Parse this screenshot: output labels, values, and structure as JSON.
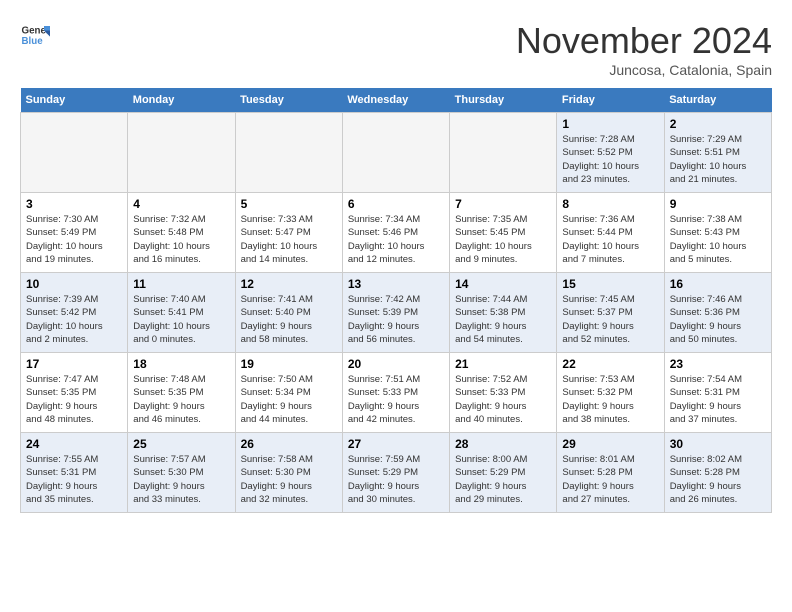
{
  "logo": {
    "line1": "General",
    "line2": "Blue"
  },
  "title": "November 2024",
  "subtitle": "Juncosa, Catalonia, Spain",
  "weekdays": [
    "Sunday",
    "Monday",
    "Tuesday",
    "Wednesday",
    "Thursday",
    "Friday",
    "Saturday"
  ],
  "weeks": [
    [
      {
        "day": "",
        "info": ""
      },
      {
        "day": "",
        "info": ""
      },
      {
        "day": "",
        "info": ""
      },
      {
        "day": "",
        "info": ""
      },
      {
        "day": "",
        "info": ""
      },
      {
        "day": "1",
        "info": "Sunrise: 7:28 AM\nSunset: 5:52 PM\nDaylight: 10 hours\nand 23 minutes."
      },
      {
        "day": "2",
        "info": "Sunrise: 7:29 AM\nSunset: 5:51 PM\nDaylight: 10 hours\nand 21 minutes."
      }
    ],
    [
      {
        "day": "3",
        "info": "Sunrise: 7:30 AM\nSunset: 5:49 PM\nDaylight: 10 hours\nand 19 minutes."
      },
      {
        "day": "4",
        "info": "Sunrise: 7:32 AM\nSunset: 5:48 PM\nDaylight: 10 hours\nand 16 minutes."
      },
      {
        "day": "5",
        "info": "Sunrise: 7:33 AM\nSunset: 5:47 PM\nDaylight: 10 hours\nand 14 minutes."
      },
      {
        "day": "6",
        "info": "Sunrise: 7:34 AM\nSunset: 5:46 PM\nDaylight: 10 hours\nand 12 minutes."
      },
      {
        "day": "7",
        "info": "Sunrise: 7:35 AM\nSunset: 5:45 PM\nDaylight: 10 hours\nand 9 minutes."
      },
      {
        "day": "8",
        "info": "Sunrise: 7:36 AM\nSunset: 5:44 PM\nDaylight: 10 hours\nand 7 minutes."
      },
      {
        "day": "9",
        "info": "Sunrise: 7:38 AM\nSunset: 5:43 PM\nDaylight: 10 hours\nand 5 minutes."
      }
    ],
    [
      {
        "day": "10",
        "info": "Sunrise: 7:39 AM\nSunset: 5:42 PM\nDaylight: 10 hours\nand 2 minutes."
      },
      {
        "day": "11",
        "info": "Sunrise: 7:40 AM\nSunset: 5:41 PM\nDaylight: 10 hours\nand 0 minutes."
      },
      {
        "day": "12",
        "info": "Sunrise: 7:41 AM\nSunset: 5:40 PM\nDaylight: 9 hours\nand 58 minutes."
      },
      {
        "day": "13",
        "info": "Sunrise: 7:42 AM\nSunset: 5:39 PM\nDaylight: 9 hours\nand 56 minutes."
      },
      {
        "day": "14",
        "info": "Sunrise: 7:44 AM\nSunset: 5:38 PM\nDaylight: 9 hours\nand 54 minutes."
      },
      {
        "day": "15",
        "info": "Sunrise: 7:45 AM\nSunset: 5:37 PM\nDaylight: 9 hours\nand 52 minutes."
      },
      {
        "day": "16",
        "info": "Sunrise: 7:46 AM\nSunset: 5:36 PM\nDaylight: 9 hours\nand 50 minutes."
      }
    ],
    [
      {
        "day": "17",
        "info": "Sunrise: 7:47 AM\nSunset: 5:35 PM\nDaylight: 9 hours\nand 48 minutes."
      },
      {
        "day": "18",
        "info": "Sunrise: 7:48 AM\nSunset: 5:35 PM\nDaylight: 9 hours\nand 46 minutes."
      },
      {
        "day": "19",
        "info": "Sunrise: 7:50 AM\nSunset: 5:34 PM\nDaylight: 9 hours\nand 44 minutes."
      },
      {
        "day": "20",
        "info": "Sunrise: 7:51 AM\nSunset: 5:33 PM\nDaylight: 9 hours\nand 42 minutes."
      },
      {
        "day": "21",
        "info": "Sunrise: 7:52 AM\nSunset: 5:33 PM\nDaylight: 9 hours\nand 40 minutes."
      },
      {
        "day": "22",
        "info": "Sunrise: 7:53 AM\nSunset: 5:32 PM\nDaylight: 9 hours\nand 38 minutes."
      },
      {
        "day": "23",
        "info": "Sunrise: 7:54 AM\nSunset: 5:31 PM\nDaylight: 9 hours\nand 37 minutes."
      }
    ],
    [
      {
        "day": "24",
        "info": "Sunrise: 7:55 AM\nSunset: 5:31 PM\nDaylight: 9 hours\nand 35 minutes."
      },
      {
        "day": "25",
        "info": "Sunrise: 7:57 AM\nSunset: 5:30 PM\nDaylight: 9 hours\nand 33 minutes."
      },
      {
        "day": "26",
        "info": "Sunrise: 7:58 AM\nSunset: 5:30 PM\nDaylight: 9 hours\nand 32 minutes."
      },
      {
        "day": "27",
        "info": "Sunrise: 7:59 AM\nSunset: 5:29 PM\nDaylight: 9 hours\nand 30 minutes."
      },
      {
        "day": "28",
        "info": "Sunrise: 8:00 AM\nSunset: 5:29 PM\nDaylight: 9 hours\nand 29 minutes."
      },
      {
        "day": "29",
        "info": "Sunrise: 8:01 AM\nSunset: 5:28 PM\nDaylight: 9 hours\nand 27 minutes."
      },
      {
        "day": "30",
        "info": "Sunrise: 8:02 AM\nSunset: 5:28 PM\nDaylight: 9 hours\nand 26 minutes."
      }
    ]
  ],
  "alt_rows": [
    0,
    2,
    4
  ],
  "colors": {
    "header_bg": "#3a7abf",
    "header_text": "#ffffff",
    "alt_row_bg": "#e8eef7",
    "normal_row_bg": "#ffffff",
    "empty_bg": "#f5f5f5"
  }
}
